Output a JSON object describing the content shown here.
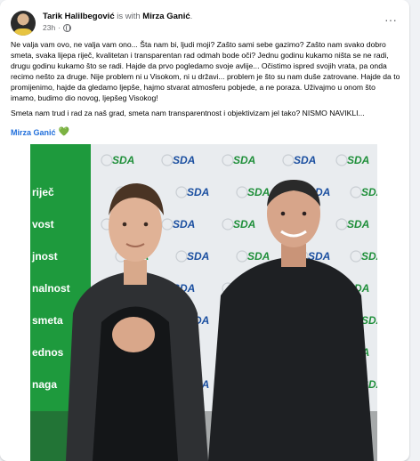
{
  "post": {
    "author": "Tarik Halilbegović",
    "with_text": "is with",
    "tagged": "Mirza Ganić",
    "time": "23h",
    "dot": "·",
    "more": "···",
    "paragraph1": "Ne valja vam ovo, ne valja vam ono... Šta nam bi, ljudi moji? Zašto sami sebe gazimo? Zašto nam svako dobro smeta, svaka lijepa riječ, kvalitetan i transparentan rad odmah bode oči? Jednu godinu kukamo ništa se ne radi, drugu godinu kukamo što se radi. Hajde da prvo pogledamo svoje avlije... Očistimo ispred svojih vrata, pa onda recimo nešto za druge. Nije problem ni u Visokom, ni u državi... problem je što su nam duše zatrovane. Hajde da to promijenimo, hajde da gledamo ljepše, hajmo stvarat atmosferu pobjede, a ne poraza. Uživajmo u onom što imamo, budimo dio novog, ljepšeg Visokog!",
    "paragraph2": "Smeta nam trud i rad za naš grad, smeta nam transparentnost i objektivizam jel tako? NISMO NAVIKLI...",
    "tag_line": "Mirza Ganić",
    "heart": "💚"
  },
  "photo": {
    "banner_words": [
      "riječ",
      "vost",
      "jnost",
      "nalnost",
      "smeta",
      "ednos",
      "naga"
    ],
    "logo_text": "SDA"
  },
  "colors": {
    "accent": "#216fdb",
    "green": "#31a24c",
    "sda_green": "#1f8f3a",
    "sda_blue": "#1b4fa0"
  }
}
